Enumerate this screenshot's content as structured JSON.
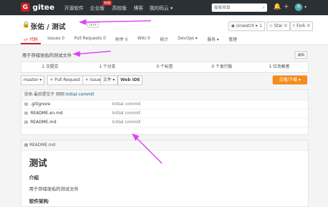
{
  "topbar": {
    "brand": "gitee",
    "nav": [
      "开源软件",
      "企业版",
      "高校版",
      "博客",
      "我的码云 ▾"
    ],
    "badge": "特惠",
    "search_placeholder": "搜索项目",
    "avatar_text": "张"
  },
  "repo": {
    "title": "张佑 / 测试",
    "lang": "Java",
    "unwatch_label": "◉ Unwatch ▾",
    "unwatch_count": "1",
    "star_label": "☆ Star",
    "star_count": "0",
    "fork_label": "⑂ Fork",
    "fork_count": "0"
  },
  "tabs": [
    "‹/› 代码",
    "Issues 0",
    "Pull Requests 0",
    "附件 0",
    "Wiki 0",
    "统计",
    "DevOps ▾",
    "服务 ▾",
    "管理"
  ],
  "description": "用于存储张佑的测试文件",
  "edit_label": "编辑",
  "stats": [
    "1 次提交",
    "1 个分支",
    "0 个标签",
    "0 个发行版",
    "1 位贡献者"
  ],
  "toolbar": {
    "branch": "master ▾",
    "pull_request": "+ Pull Request",
    "issue": "+ Issue",
    "file": "文件 ▾",
    "webide": "Web IDE",
    "download": "克隆/下载 ▾"
  },
  "commit": {
    "text": "张佑 最后提交于 刚刚 ",
    "message": "Initial commit"
  },
  "files": [
    {
      "name": ".gitignore",
      "message": "Initial commit"
    },
    {
      "name": "README.en.md",
      "message": "Initial commit"
    },
    {
      "name": "README.md",
      "message": "Initial commit"
    }
  ],
  "readme": {
    "header": "README.md",
    "h1": "测试",
    "h2": "介绍",
    "p": "用于存储张佑的测试文件",
    "h2b": "软件架构"
  },
  "annotation_color": "#e040fb"
}
